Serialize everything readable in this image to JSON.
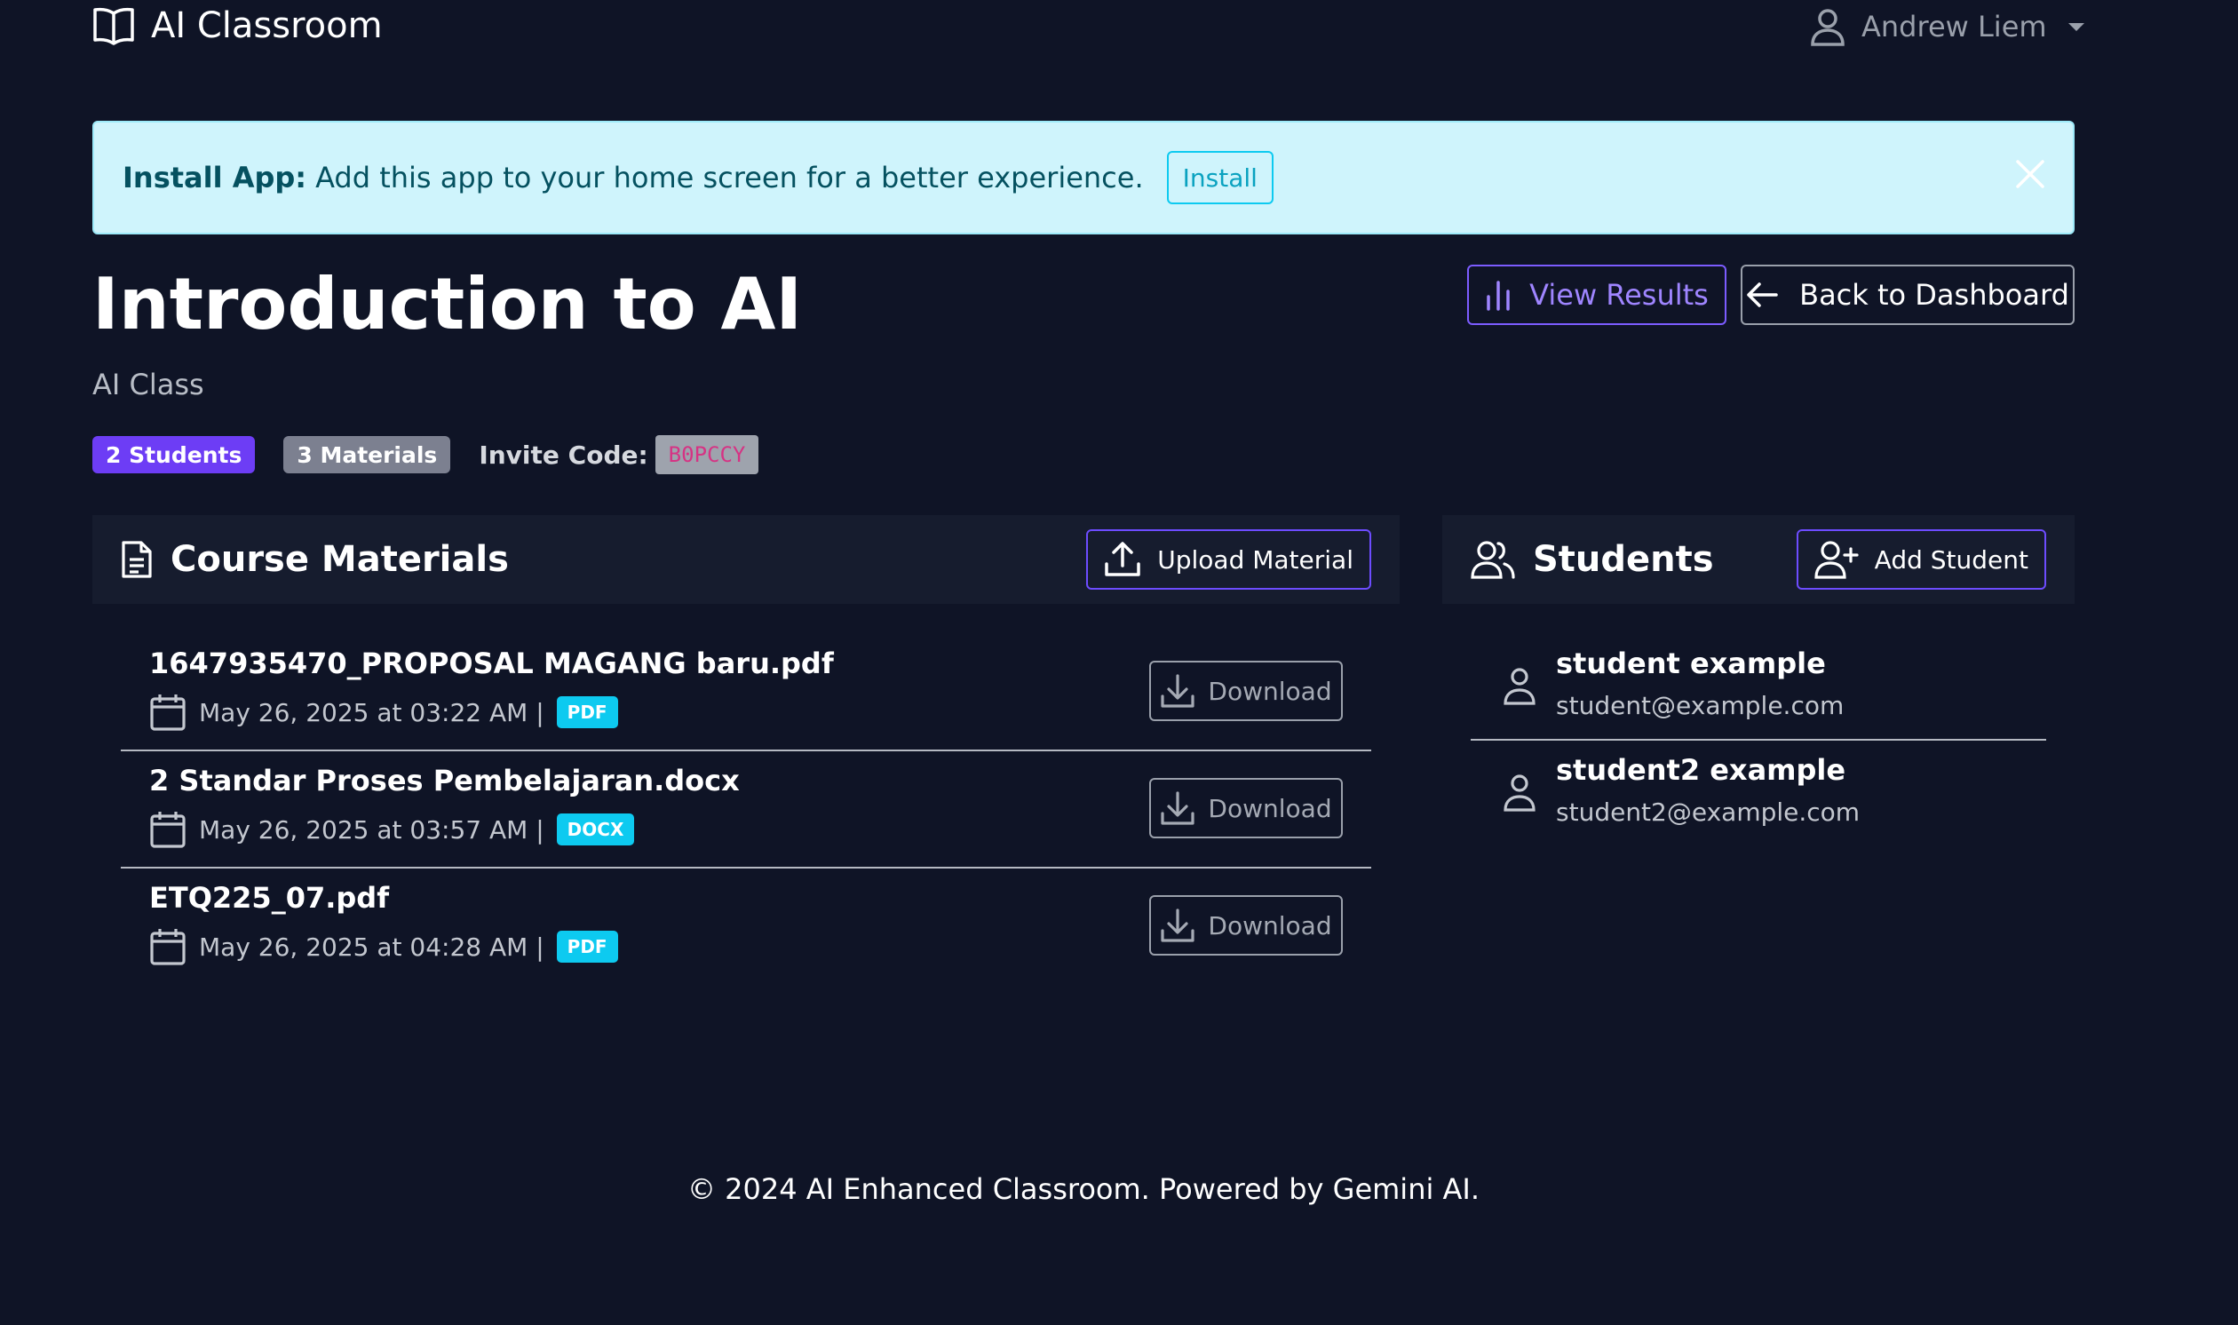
{
  "nav": {
    "brand": "AI Classroom",
    "user_name": "Andrew Liem"
  },
  "alert": {
    "title": "Install App:",
    "message": "Add this app to your home screen for a better experience.",
    "install_label": "Install"
  },
  "course": {
    "title": "Introduction to AI",
    "subtitle": "AI Class",
    "students_badge": "2 Students",
    "materials_badge": "3 Materials",
    "invite_label": "Invite Code:",
    "invite_code": "B0PCCY"
  },
  "actions": {
    "view_results": "View Results",
    "back_dashboard": "Back to Dashboard"
  },
  "materials": {
    "heading": "Course Materials",
    "upload_label": "Upload Material",
    "items": [
      {
        "name": "1647935470_PROPOSAL MAGANG baru.pdf",
        "date": "May 26, 2025 at 03:22 AM |",
        "type": "PDF",
        "download": "Download"
      },
      {
        "name": "2 Standar Proses Pembelajaran.docx",
        "date": "May 26, 2025 at 03:57 AM |",
        "type": "DOCX",
        "download": "Download"
      },
      {
        "name": "ETQ225_07.pdf",
        "date": "May 26, 2025 at 04:28 AM |",
        "type": "PDF",
        "download": "Download"
      }
    ]
  },
  "students": {
    "heading": "Students",
    "add_label": "Add Student",
    "items": [
      {
        "name": "student example",
        "email": "student@example.com"
      },
      {
        "name": "student2 example",
        "email": "student2@example.com"
      }
    ]
  },
  "footer": {
    "text": "© 2024 AI Enhanced Classroom. Powered by Gemini AI."
  },
  "colors": {
    "background": "#0f1426",
    "accent": "#6d4cff",
    "info": "#0dcaf0"
  },
  "icons": [
    "book-icon",
    "user-icon",
    "close-icon",
    "bar-chart-icon",
    "arrow-left-icon",
    "document-icon",
    "upload-icon",
    "calendar-icon",
    "download-icon",
    "people-icon",
    "person-add-icon"
  ]
}
